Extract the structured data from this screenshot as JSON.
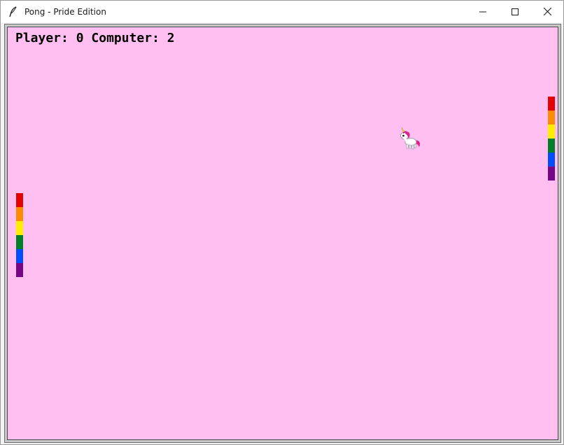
{
  "window": {
    "title": "Pong - Pride Edition",
    "icon": "feather-icon",
    "controls": [
      "minimize-icon",
      "maximize-icon",
      "close-icon"
    ]
  },
  "game": {
    "background_color": "#ffbff0",
    "score": {
      "player_label": "Player:",
      "player_value": "0",
      "computer_label": "Computer:",
      "computer_value": "2"
    },
    "paddle_colors": [
      "#e40303",
      "#ff8c00",
      "#ffed00",
      "#008026",
      "#004dff",
      "#750787"
    ],
    "ball": "unicorn-sprite"
  }
}
